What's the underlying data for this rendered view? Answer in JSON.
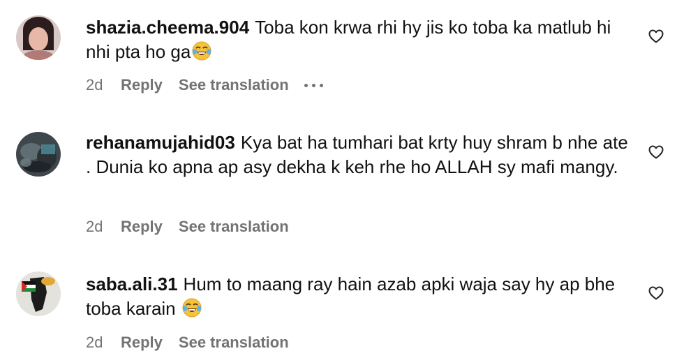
{
  "comments": [
    {
      "username": "shazia.cheema.904",
      "text": "Toba kon krwa rhi hy jis ko toba ka matlub hi nhi pta ho ga",
      "emoji": "laughing-tears",
      "age": "2d",
      "reply_label": "Reply",
      "translation_label": "See translation",
      "avatar": "woman-portrait"
    },
    {
      "username": "rehanamujahid03",
      "text": "Kya bat ha tumhari bat krty huy shram b nhe ate . Dunia ko apna ap asy dekha k keh rhe ho ALLAH sy mafi mangy.",
      "age": "2d",
      "reply_label": "Reply",
      "translation_label": "See translation",
      "avatar": "blurred-photo"
    },
    {
      "username": "saba.ali.31",
      "text": "Hum to maang ray hain azab apki waja say hy ap bhe toba karain",
      "emoji": "laughing-tears",
      "age": "2d",
      "reply_label": "Reply",
      "translation_label": "See translation",
      "avatar": "palestine-map-flag"
    }
  ],
  "icons": {
    "like": "heart-outline-icon",
    "more": "more-options-icon"
  },
  "colors": {
    "text": "#111111",
    "meta": "#737373",
    "background": "#ffffff"
  }
}
